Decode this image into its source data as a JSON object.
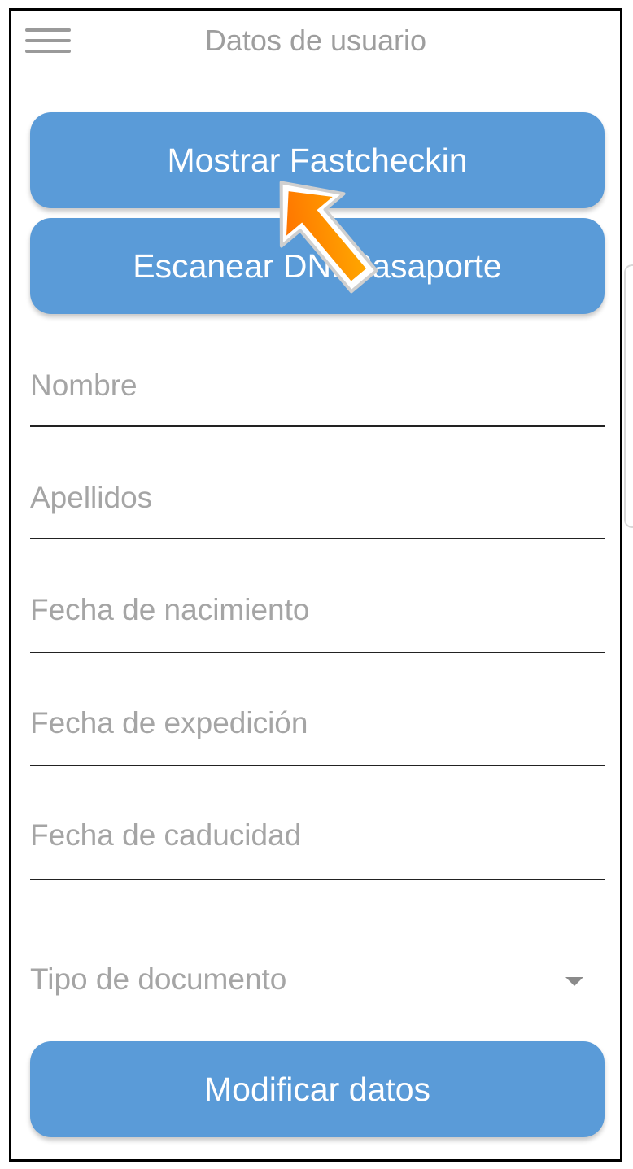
{
  "header": {
    "title": "Datos de usuario",
    "menu_icon": "hamburger-menu-icon"
  },
  "buttons": {
    "show_fastcheckin": "Mostrar Fastcheckin",
    "scan_document": "Escanear DNI/Pasaporte",
    "modify_data": "Modificar datos"
  },
  "form": {
    "first_name_placeholder": "Nombre",
    "last_name_placeholder": "Apellidos",
    "birth_date_placeholder": "Fecha de nacimiento",
    "issue_date_placeholder": "Fecha de expedición",
    "expiry_date_placeholder": "Fecha de caducidad",
    "document_type_placeholder": "Tipo de documento"
  },
  "colors": {
    "button_blue": "#5a9bd8",
    "arrow_orange": "#ff8c00",
    "placeholder_grey": "#a5a5a5"
  },
  "overlay": {
    "pointer_icon": "orange-arrow-pointer-icon"
  }
}
